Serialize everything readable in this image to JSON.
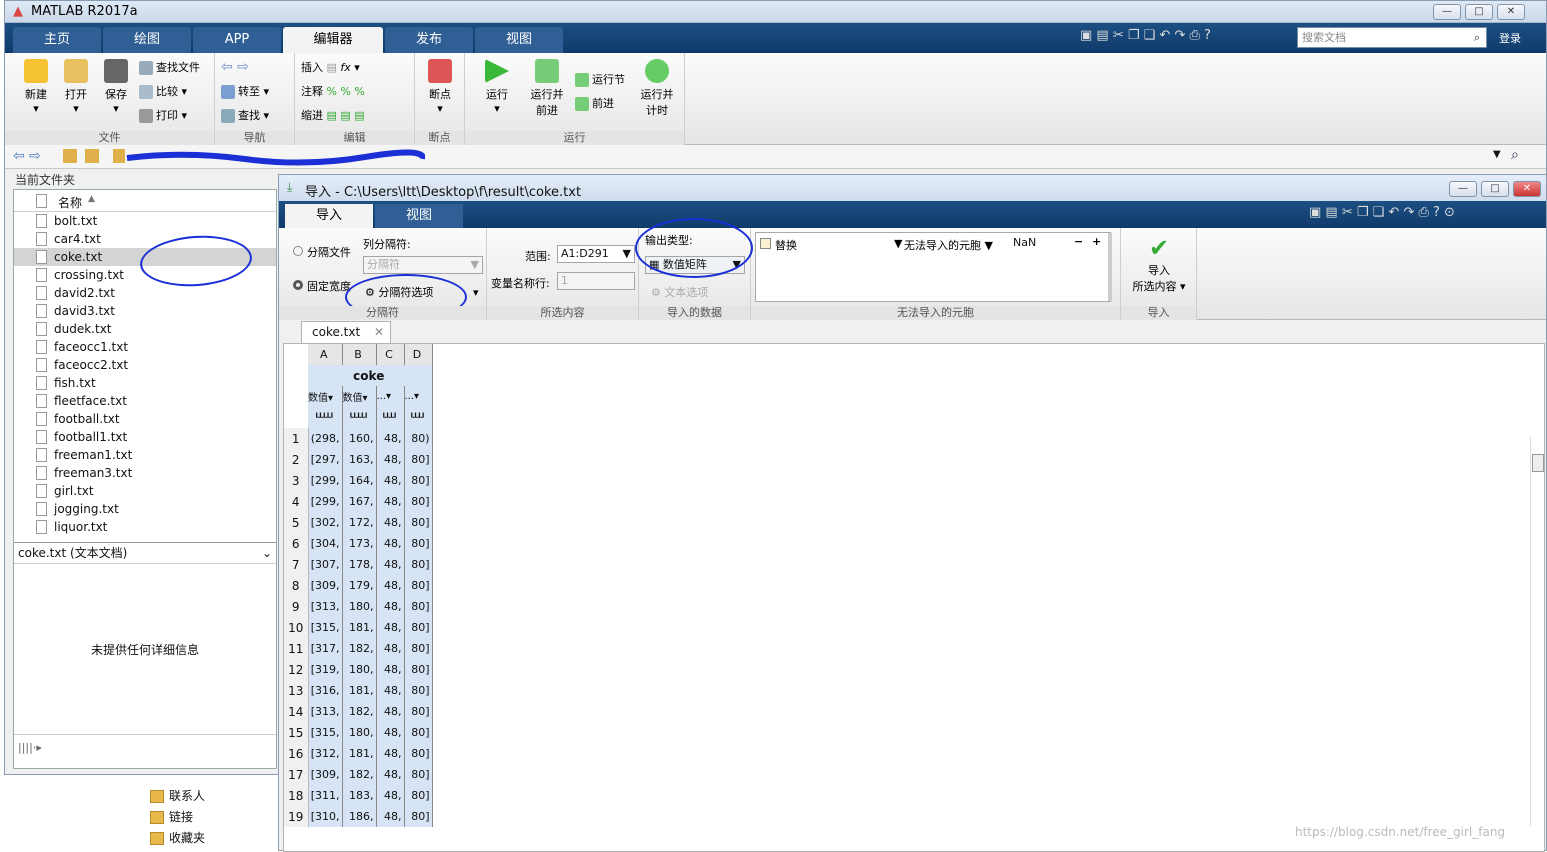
{
  "main_window": {
    "title": "MATLAB R2017a",
    "tabs": [
      "主页",
      "绘图",
      "APP",
      "编辑器",
      "发布",
      "视图"
    ],
    "active_tab": "编辑器",
    "search_placeholder": "搜索文档",
    "login": "登录",
    "groups": {
      "file": {
        "label": "文件",
        "new": "新建",
        "open": "打开",
        "save": "保存",
        "find_files": "查找文件",
        "compare": "比较",
        "print": "打印"
      },
      "navigate": {
        "label": "导航",
        "goto": "转至",
        "find": "查找"
      },
      "edit": {
        "label": "编辑",
        "insert": "插入",
        "comment": "注释",
        "indent": "缩进",
        "fx": "fx"
      },
      "breakpoints": {
        "label": "断点",
        "breakpoints": "断点"
      },
      "run": {
        "label": "运行",
        "run": "运行",
        "run_advance": "运行并\n前进",
        "run_section": "运行节",
        "advance": "前进",
        "run_time": "运行并\n计时"
      }
    }
  },
  "current_folder": {
    "title": "当前文件夹",
    "column_name": "名称",
    "files": [
      "bolt.txt",
      "car4.txt",
      "coke.txt",
      "crossing.txt",
      "david2.txt",
      "david3.txt",
      "dudek.txt",
      "faceocc1.txt",
      "faceocc2.txt",
      "fish.txt",
      "fleetface.txt",
      "football.txt",
      "football1.txt",
      "freeman1.txt",
      "freeman3.txt",
      "girl.txt",
      "jogging.txt",
      "liquor.txt"
    ],
    "selected_file": "coke.txt",
    "details_header": "coke.txt  (文本文档)",
    "details_body": "未提供任何详细信息"
  },
  "import_window": {
    "title": "导入 - C:\\Users\\ltt\\Desktop\\f\\result\\coke.txt",
    "tabs": [
      "导入",
      "视图"
    ],
    "delimited_label": "分隔文件",
    "fixed_width_label": "固定宽度",
    "column_delimiter_label": "列分隔符:",
    "delimiter_placeholder": "分隔符",
    "delimiter_options": "分隔符选项",
    "group_delimiter": "分隔符",
    "range_label": "范围:",
    "range_value": "A1:D291",
    "varname_row_label": "变量名称行:",
    "varname_row_value": "1",
    "group_selection": "所选内容",
    "output_type_label": "输出类型:",
    "output_type_value": "数值矩阵",
    "text_options": "文本选项",
    "group_imported_data": "导入的数据",
    "replace_label": "替换",
    "unimportable_label": "无法导入的元胞",
    "nan_value": "NaN",
    "group_unimportable": "无法导入的元胞",
    "import_selection": "导入\n所选内容",
    "group_import": "导入",
    "doc_tab": "coke.txt",
    "grid": {
      "columns": [
        "A",
        "B",
        "C",
        "D"
      ],
      "var_name": "coke",
      "types": [
        "数值",
        "数值",
        "...",
        "..."
      ],
      "rows": [
        [
          "(298,",
          "160,",
          "48,",
          "80)"
        ],
        [
          "[297,",
          "163,",
          "48,",
          "80]"
        ],
        [
          "[299,",
          "164,",
          "48,",
          "80]"
        ],
        [
          "[299,",
          "167,",
          "48,",
          "80]"
        ],
        [
          "[302,",
          "172,",
          "48,",
          "80]"
        ],
        [
          "[304,",
          "173,",
          "48,",
          "80]"
        ],
        [
          "[307,",
          "178,",
          "48,",
          "80]"
        ],
        [
          "[309,",
          "179,",
          "48,",
          "80]"
        ],
        [
          "[313,",
          "180,",
          "48,",
          "80]"
        ],
        [
          "[315,",
          "181,",
          "48,",
          "80]"
        ],
        [
          "[317,",
          "182,",
          "48,",
          "80]"
        ],
        [
          "[319,",
          "180,",
          "48,",
          "80]"
        ],
        [
          "[316,",
          "181,",
          "48,",
          "80]"
        ],
        [
          "[313,",
          "182,",
          "48,",
          "80]"
        ],
        [
          "[315,",
          "180,",
          "48,",
          "80]"
        ],
        [
          "[312,",
          "181,",
          "48,",
          "80]"
        ],
        [
          "[309,",
          "182,",
          "48,",
          "80]"
        ],
        [
          "[311,",
          "183,",
          "48,",
          "80]"
        ],
        [
          "[310,",
          "186,",
          "48,",
          "80]"
        ]
      ]
    }
  },
  "explorer": {
    "items": [
      "联系人",
      "链接",
      "收藏夹"
    ]
  },
  "watermark": "https://blog.csdn.net/free_girl_fang"
}
